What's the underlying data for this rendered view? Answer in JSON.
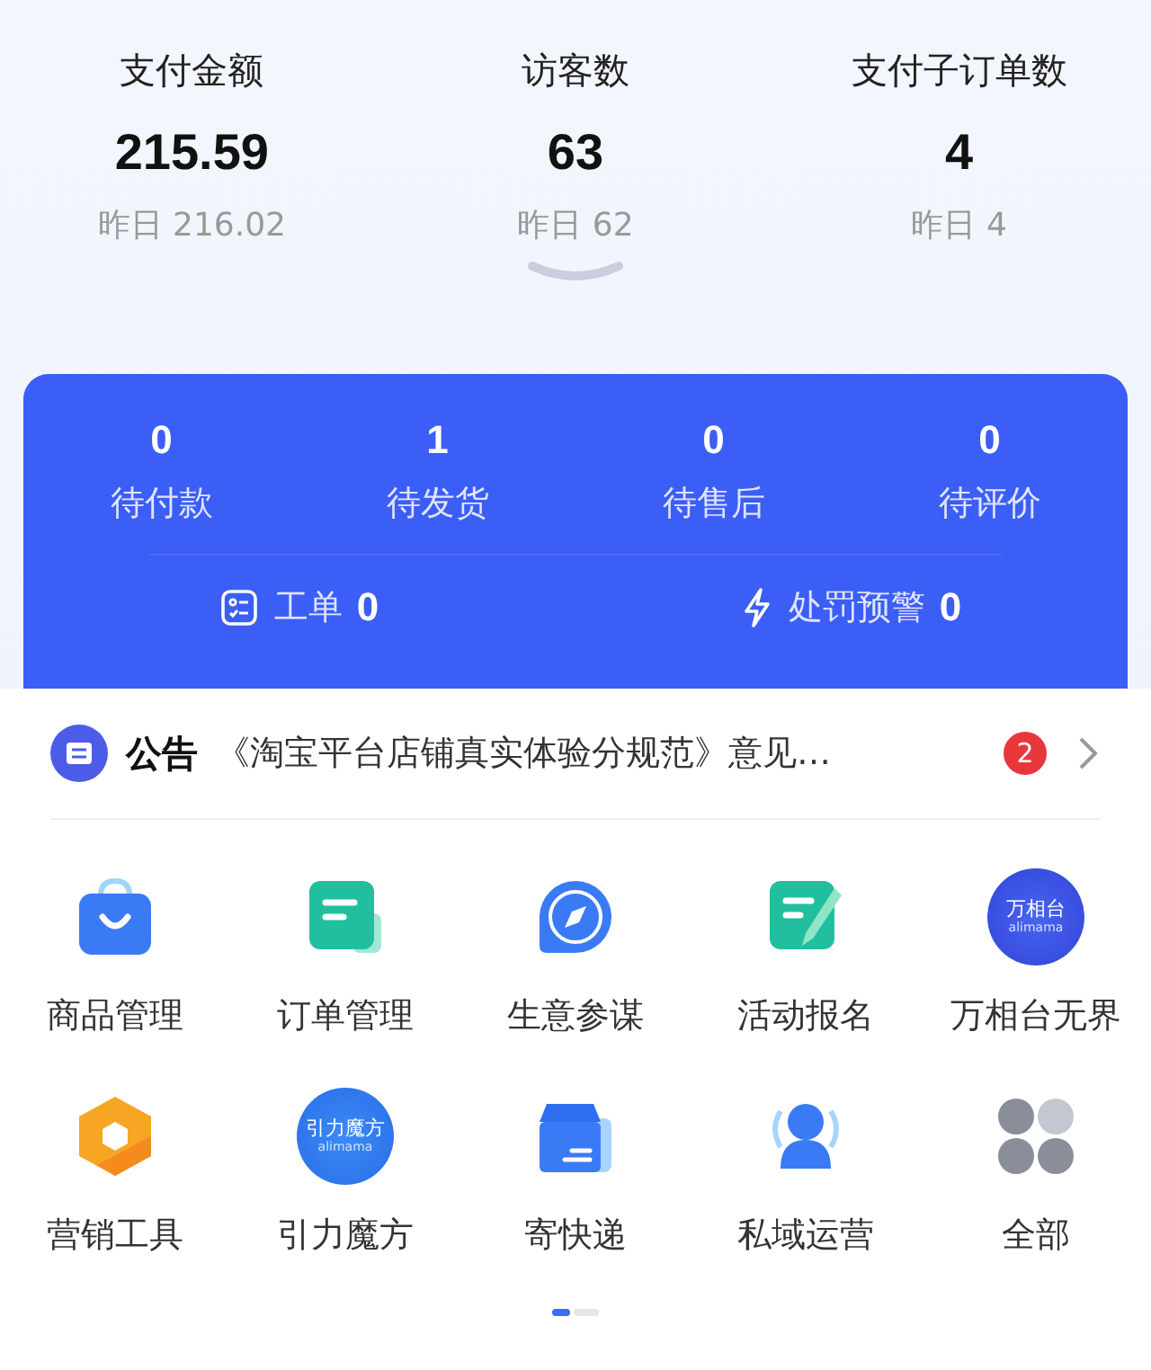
{
  "stats": [
    {
      "label": "支付金额",
      "value": "215.59",
      "yesterday": "昨日 216.02"
    },
    {
      "label": "访客数",
      "value": "63",
      "yesterday": "昨日 62"
    },
    {
      "label": "支付子订单数",
      "value": "4",
      "yesterday": "昨日 4"
    }
  ],
  "orders": [
    {
      "count": "0",
      "label": "待付款"
    },
    {
      "count": "1",
      "label": "待发货"
    },
    {
      "count": "0",
      "label": "待售后"
    },
    {
      "count": "0",
      "label": "待评价"
    }
  ],
  "extras": [
    {
      "label": "工单",
      "count": "0"
    },
    {
      "label": "处罚预警",
      "count": "0"
    }
  ],
  "notice": {
    "tag": "公告",
    "text": "《淘宝平台店铺真实体验分规范》意见…",
    "badge": "2"
  },
  "tools": [
    {
      "label": "商品管理"
    },
    {
      "label": "订单管理"
    },
    {
      "label": "生意参谋"
    },
    {
      "label": "活动报名"
    },
    {
      "label": "万相台无界",
      "logo": {
        "title": "万相台",
        "subtitle": "alimama"
      }
    },
    {
      "label": "营销工具"
    },
    {
      "label": "引力魔方",
      "logo": {
        "title": "引力魔方",
        "subtitle": "alimama"
      }
    },
    {
      "label": "寄快递"
    },
    {
      "label": "私域运营"
    },
    {
      "label": "全部"
    }
  ],
  "pages": [
    {
      "selected": true
    },
    {
      "selected": false
    }
  ]
}
